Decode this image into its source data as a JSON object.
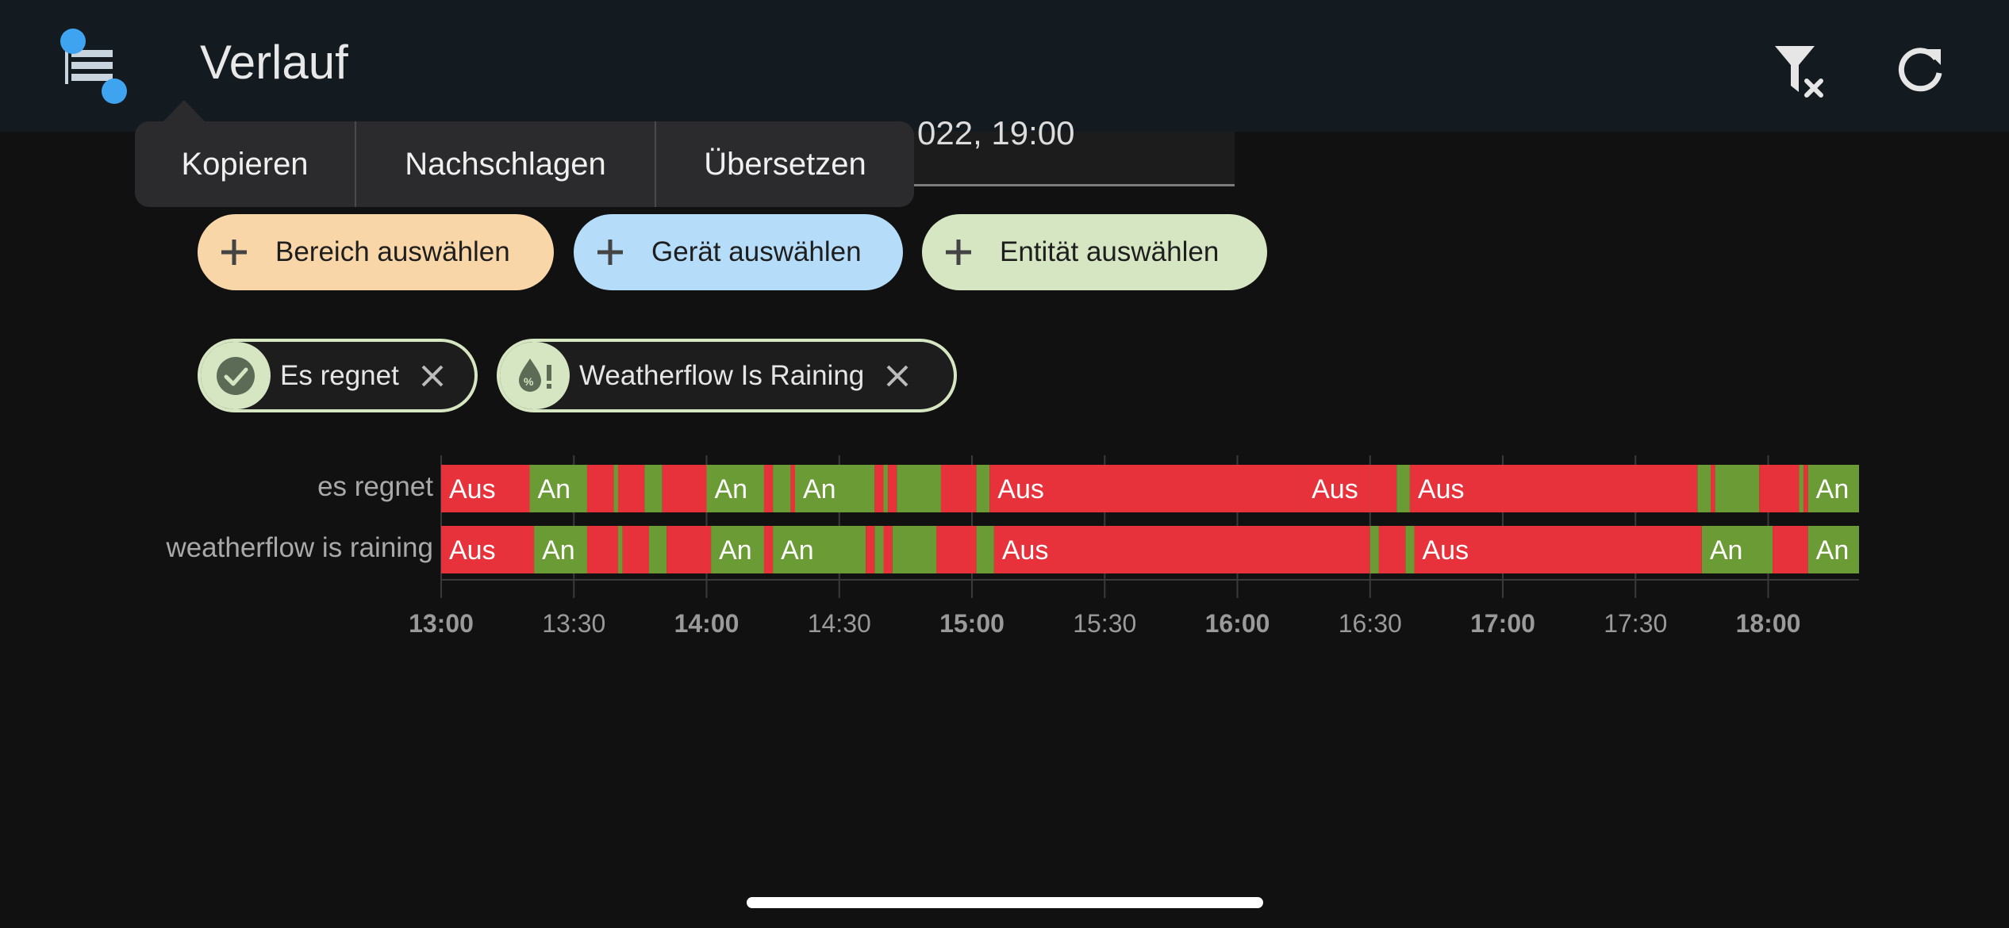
{
  "header": {
    "title": "Verlauf"
  },
  "date_field": {
    "value": "022, 19:00"
  },
  "context_menu": {
    "items": [
      "Kopieren",
      "Nachschlagen",
      "Übersetzen"
    ]
  },
  "target_buttons": [
    {
      "label": "Bereich auswählen",
      "color": "#f8d6a8"
    },
    {
      "label": "Gerät auswählen",
      "color": "#b5dcf8"
    },
    {
      "label": "Entität auswählen",
      "color": "#d6e6c2"
    }
  ],
  "selected_entities": [
    {
      "label": "Es regnet",
      "icon": "check-circle-icon"
    },
    {
      "label": "Weatherflow Is Raining",
      "icon": "water-percent-alert-icon"
    }
  ],
  "colors": {
    "on": "#6a9b35",
    "off": "#e8323b"
  },
  "chart_data": {
    "type": "timeline",
    "x_ticks": [
      "13:00",
      "13:30",
      "14:00",
      "14:30",
      "15:00",
      "15:30",
      "16:00",
      "16:30",
      "17:00",
      "17:30",
      "18:00"
    ],
    "x_ticks_bold": [
      "13:00",
      "14:00",
      "15:00",
      "16:00",
      "17:00",
      "18:00"
    ],
    "x_range": [
      "13:00",
      "18:20"
    ],
    "rows": [
      {
        "name": "es regnet",
        "segments": [
          {
            "start": "13:00",
            "end": "13:20",
            "state": "Aus"
          },
          {
            "start": "13:20",
            "end": "13:33",
            "state": "An"
          },
          {
            "start": "13:33",
            "end": "13:39",
            "state": "Aus"
          },
          {
            "start": "13:39",
            "end": "13:40",
            "state": "An"
          },
          {
            "start": "13:40",
            "end": "13:46",
            "state": "Aus"
          },
          {
            "start": "13:46",
            "end": "13:50",
            "state": "An"
          },
          {
            "start": "13:50",
            "end": "14:00",
            "state": "Aus"
          },
          {
            "start": "14:00",
            "end": "14:13",
            "state": "An"
          },
          {
            "start": "14:13",
            "end": "14:15",
            "state": "Aus"
          },
          {
            "start": "14:15",
            "end": "14:19",
            "state": "An"
          },
          {
            "start": "14:19",
            "end": "14:20",
            "state": "Aus"
          },
          {
            "start": "14:20",
            "end": "14:38",
            "state": "An"
          },
          {
            "start": "14:38",
            "end": "14:40",
            "state": "Aus"
          },
          {
            "start": "14:40",
            "end": "14:41",
            "state": "An"
          },
          {
            "start": "14:41",
            "end": "14:43",
            "state": "Aus"
          },
          {
            "start": "14:43",
            "end": "14:53",
            "state": "An"
          },
          {
            "start": "14:53",
            "end": "15:01",
            "state": "Aus"
          },
          {
            "start": "15:01",
            "end": "15:04",
            "state": "An"
          },
          {
            "start": "15:04",
            "end": "16:15",
            "state": "Aus"
          },
          {
            "start": "16:15",
            "end": "16:15",
            "state": "An"
          },
          {
            "start": "16:15",
            "end": "16:30",
            "state": "Aus"
          },
          {
            "start": "16:30",
            "end": "16:30",
            "state": "An"
          },
          {
            "start": "16:30",
            "end": "16:36",
            "state": "Aus"
          },
          {
            "start": "16:36",
            "end": "16:39",
            "state": "An"
          },
          {
            "start": "16:39",
            "end": "17:44",
            "state": "Aus"
          },
          {
            "start": "17:44",
            "end": "17:47",
            "state": "An"
          },
          {
            "start": "17:47",
            "end": "17:48",
            "state": "Aus"
          },
          {
            "start": "17:48",
            "end": "17:58",
            "state": "An"
          },
          {
            "start": "17:58",
            "end": "18:07",
            "state": "Aus"
          },
          {
            "start": "18:07",
            "end": "18:08",
            "state": "An"
          },
          {
            "start": "18:08",
            "end": "18:09",
            "state": "Aus"
          },
          {
            "start": "18:09",
            "end": "18:21",
            "state": "An"
          }
        ]
      },
      {
        "name": "weatherflow is raining",
        "segments": [
          {
            "start": "13:00",
            "end": "13:21",
            "state": "Aus"
          },
          {
            "start": "13:21",
            "end": "13:33",
            "state": "An"
          },
          {
            "start": "13:33",
            "end": "13:40",
            "state": "Aus"
          },
          {
            "start": "13:40",
            "end": "13:41",
            "state": "An"
          },
          {
            "start": "13:41",
            "end": "13:47",
            "state": "Aus"
          },
          {
            "start": "13:47",
            "end": "13:51",
            "state": "An"
          },
          {
            "start": "13:51",
            "end": "14:01",
            "state": "Aus"
          },
          {
            "start": "14:01",
            "end": "14:13",
            "state": "An"
          },
          {
            "start": "14:13",
            "end": "14:15",
            "state": "Aus"
          },
          {
            "start": "14:15",
            "end": "14:36",
            "state": "An"
          },
          {
            "start": "14:36",
            "end": "14:38",
            "state": "Aus"
          },
          {
            "start": "14:38",
            "end": "14:40",
            "state": "An"
          },
          {
            "start": "14:40",
            "end": "14:42",
            "state": "Aus"
          },
          {
            "start": "14:42",
            "end": "14:52",
            "state": "An"
          },
          {
            "start": "14:52",
            "end": "15:01",
            "state": "Aus"
          },
          {
            "start": "15:01",
            "end": "15:05",
            "state": "An"
          },
          {
            "start": "15:05",
            "end": "16:30",
            "state": "Aus"
          },
          {
            "start": "16:30",
            "end": "16:32",
            "state": "An"
          },
          {
            "start": "16:32",
            "end": "16:38",
            "state": "Aus"
          },
          {
            "start": "16:38",
            "end": "16:40",
            "state": "An"
          },
          {
            "start": "16:40",
            "end": "17:45",
            "state": "Aus"
          },
          {
            "start": "17:45",
            "end": "18:01",
            "state": "An"
          },
          {
            "start": "18:01",
            "end": "18:09",
            "state": "Aus"
          },
          {
            "start": "18:09",
            "end": "18:21",
            "state": "An"
          }
        ]
      }
    ]
  }
}
